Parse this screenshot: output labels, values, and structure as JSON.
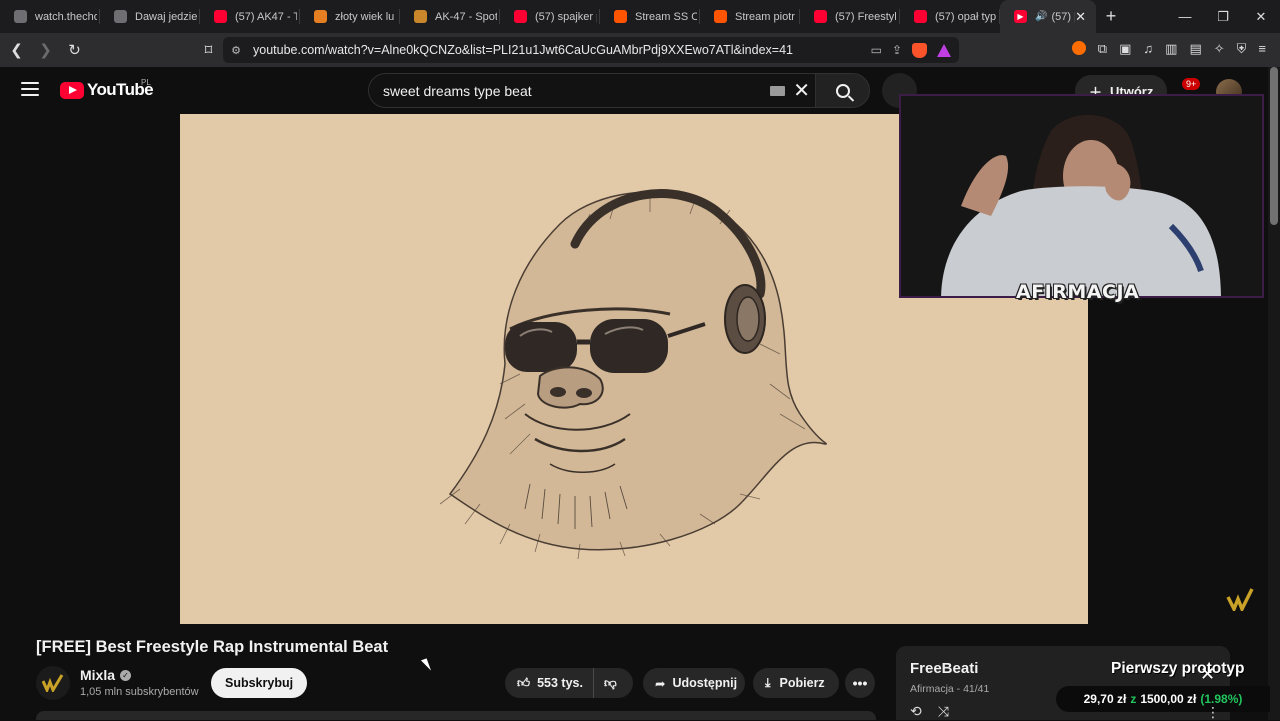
{
  "browser": {
    "tabs": [
      {
        "label": "watch.thecho",
        "icon": "globe-icon"
      },
      {
        "label": "Dawaj jedzie",
        "icon": "globe-icon"
      },
      {
        "label": "(57) AK47 - Tr",
        "icon": "youtube-icon"
      },
      {
        "label": "złoty wiek lu",
        "icon": "duckduckgo-icon"
      },
      {
        "label": "AK-47 - Spot",
        "icon": "spotify-icon"
      },
      {
        "label": "(57) spajker p",
        "icon": "youtube-icon"
      },
      {
        "label": "Stream SS Ol",
        "icon": "soundcloud-icon"
      },
      {
        "label": "Stream piotr",
        "icon": "soundcloud-icon"
      },
      {
        "label": "(57) Freestyle",
        "icon": "youtube-icon"
      },
      {
        "label": "(57) opał typ",
        "icon": "youtube-icon"
      }
    ],
    "active_tab": {
      "label": "(57) [F",
      "icon": "youtube-icon"
    },
    "url": "youtube.com/watch?v=Alne0kQCNZo&list=PLI21u1Jwt6CaUcGuAMbrPdj9XXEwo7ATl&index=41"
  },
  "youtube": {
    "logo_text": "YouTube",
    "country": "PL",
    "search_query": "sweet dreams type beat",
    "create_label": "Utwórz",
    "notifications_badge": "9+"
  },
  "overlay": {
    "webcam_label": "AFIRMACJA"
  },
  "video": {
    "title": "[FREE] Best Freestyle Rap Instrumental Beat",
    "channel": "Mixla",
    "subscribers": "1,05 mln subskrybentów",
    "subscribe_label": "Subskrybuj",
    "likes": "553 tys.",
    "share_label": "Udostępnij",
    "download_label": "Pobierz"
  },
  "playlist": {
    "title": "FreeBeati",
    "meta": "Afirmacja - 41/41"
  },
  "stream_overlay": {
    "goal_title": "Pierwszy prototyp",
    "donation_current": "29,70 zł",
    "donation_sep": "z",
    "donation_goal": "1500,00 zł",
    "donation_pct": "(1.98%)"
  }
}
